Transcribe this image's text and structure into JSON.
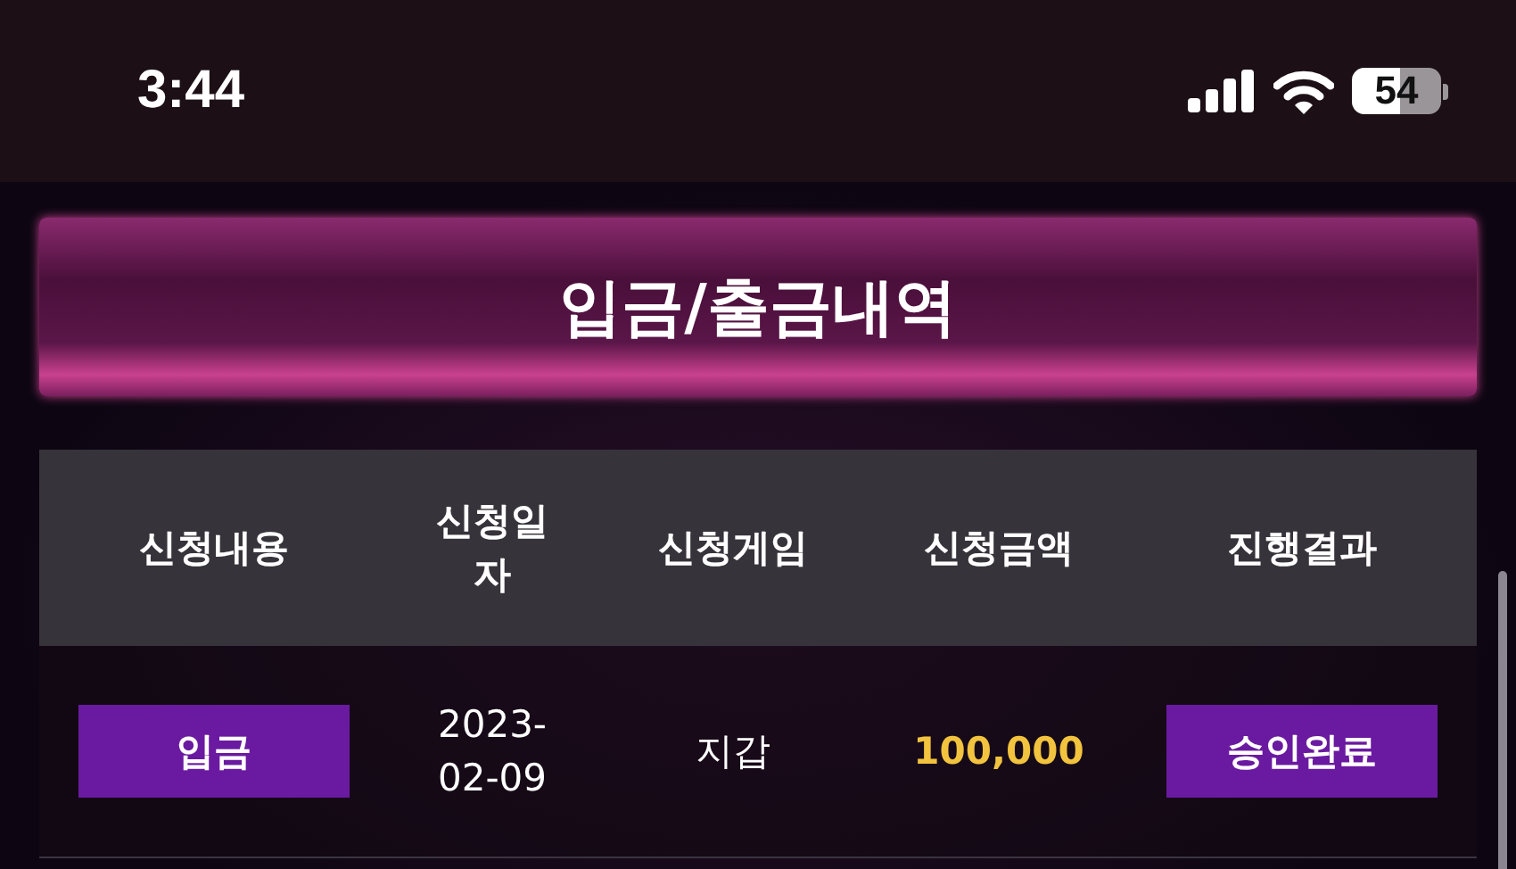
{
  "status_bar": {
    "time": "3:44",
    "battery": "54"
  },
  "title": "입금/출금내역",
  "table": {
    "columns": [
      "신청내용",
      "신청일자",
      "신청게임",
      "신청금액",
      "진행결과"
    ],
    "rows": [
      {
        "type": "입금",
        "date": "2023-02-09",
        "game": "지갑",
        "amount": "100,000",
        "result": "승인완료"
      }
    ]
  }
}
